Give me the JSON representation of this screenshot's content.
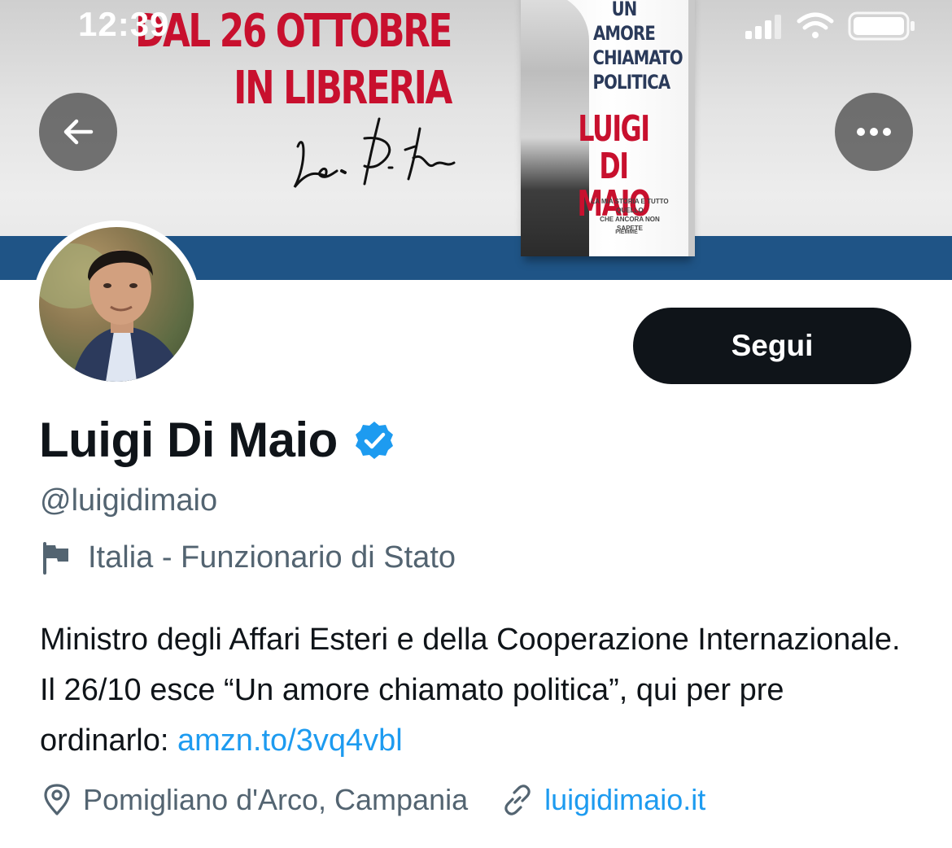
{
  "status_bar": {
    "time": "12:39",
    "icons": [
      "cellular-signal-icon",
      "wifi-icon",
      "battery-icon"
    ]
  },
  "banner": {
    "headline_line1": "DAL 26 OTTOBRE",
    "headline_line2": "IN LIBRERIA",
    "book_title": [
      "UN",
      "AMORE",
      "CHIAMATO",
      "POLITICA"
    ],
    "book_author": [
      "LUIGI",
      "DI MAIO"
    ],
    "book_tagline": [
      "LA MIA STORIA E TUTTO QUELLO",
      "CHE ANCORA NON SAPETE"
    ],
    "book_publisher": "PIEMME"
  },
  "header_buttons": {
    "back": "arrow-left-icon",
    "more": "more-horizontal-icon"
  },
  "profile": {
    "follow_label": "Segui",
    "display_name": "Luigi Di Maio",
    "verified": true,
    "handle": "@luigidimaio",
    "category": "Italia - Funzionario di Stato",
    "bio_text": "Ministro degli Affari Esteri e della Cooperazione Internazionale. Il 26/10 esce “Un amore chiamato politica”, qui per pre ordinarlo: ",
    "bio_link": "amzn.to/3vq4vbl",
    "location": "Pomigliano d'Arco, Campania",
    "website": "luigidimaio.it"
  },
  "colors": {
    "link": "#1d9bf0",
    "secondary_text": "#536471",
    "primary_text": "#0f1419",
    "banner_red": "#c8102e",
    "banner_stripe": "#1f5486"
  }
}
